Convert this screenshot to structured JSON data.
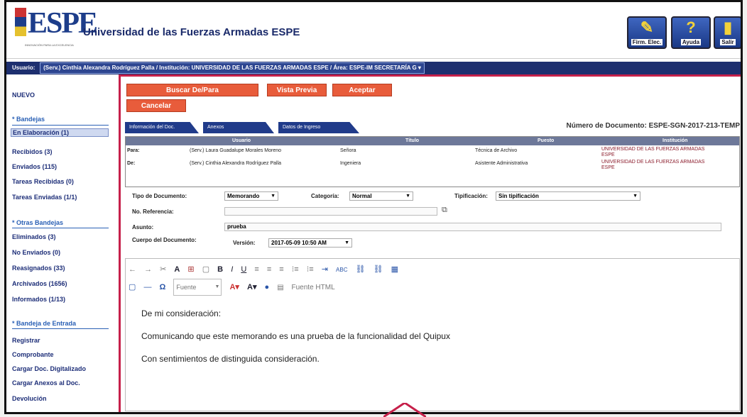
{
  "header": {
    "logo": "ESPE",
    "logo_sub": "INNOVACIÓN PARA LA EXCELENCIA",
    "university": "Universidad de las Fuerzas Armadas ESPE",
    "buttons": [
      {
        "label": "Firm. Elec.",
        "icon": "pen-icon"
      },
      {
        "label": "Ayuda",
        "icon": "help-icon"
      },
      {
        "label": "Salir",
        "icon": "exit-door-icon"
      }
    ]
  },
  "userbar": {
    "prefix": "Usuario:",
    "text": "(Serv.) Cinthia Alexandra Rodríguez Palla / Institución: UNIVERSIDAD DE LAS FUERZAS ARMADAS ESPE / Área: ESPE-IM SECRETARÍA G ▾"
  },
  "sidebar": {
    "nuevo": "NUEVO",
    "bandejas_title": "* Bandejas",
    "bandejas": [
      "En Elaboración (1)",
      "Recibidos (3)",
      "Enviados (115)",
      "Tareas Recibidas (0)",
      "Tareas Enviadas (1/1)"
    ],
    "otras_title": "* Otras Bandejas",
    "otras": [
      "Eliminados (3)",
      "No Enviados (0)",
      "Reasignados (33)",
      "Archivados (1656)",
      "Informados (1/13)"
    ],
    "entrada_title": "* Bandeja de Entrada",
    "entrada": [
      "Registrar",
      "Comprobante",
      "Cargar Doc. Digitalizado",
      "Cargar Anexos al Doc.",
      "Devolución"
    ]
  },
  "actions": {
    "buscar": "Buscar De/Para",
    "vista": "Vista Previa",
    "aceptar": "Aceptar",
    "cancelar": "Cancelar"
  },
  "tabs": [
    "Información del Doc.",
    "Anexos",
    "Datos de Ingreso"
  ],
  "doc_number": "Número de Documento: ESPE-SGN-2017-213-TEMP",
  "table": {
    "headers": [
      "Usuario",
      "Título",
      "Puesto",
      "Institución"
    ],
    "rows": [
      {
        "role": "Para:",
        "user": "(Serv.) Laura Guadalupe Morales Moreno",
        "title": "Señora",
        "puesto": "Técnica de Archivo",
        "inst": "UNIVERSIDAD DE LAS FUERZAS ARMADAS ESPE"
      },
      {
        "role": "De:",
        "user": "(Serv.) Cinthia Alexandra Rodríguez Palla",
        "title": "Ingeniera",
        "puesto": "Asistente Administrativa",
        "inst": "UNIVERSIDAD DE LAS FUERZAS ARMADAS ESPE"
      }
    ]
  },
  "form": {
    "tipo_label": "Tipo de Documento:",
    "tipo_value": "Memorando",
    "categoria_label": "Categoría:",
    "categoria_value": "Normal",
    "tipificacion_label": "Tipificación:",
    "tipificacion_value": "Sin tipificación",
    "referencia_label": "No. Referencia:",
    "asunto_label": "Asunto:",
    "asunto_value": "prueba",
    "cuerpo_label": "Cuerpo del Documento:",
    "version_label": "Versión:",
    "version_value": "2017-05-09 10:50 AM"
  },
  "editor": {
    "toolbar1": [
      "←",
      "→",
      "✂",
      "A",
      "⊞",
      "▢",
      "B",
      "I",
      "U",
      "≡",
      "≡",
      "≡",
      "⁝≡",
      "⁝≡",
      "⇥",
      "ABC",
      "⛓",
      "⛓",
      "▦"
    ],
    "font_placeholder": "Fuente",
    "source_label": "Fuente HTML",
    "paragraphs": [
      "De mi consideración:",
      "Comunicando que este memorando es una prueba de la funcionalidad del Quipux",
      "Con sentimientos de distinguida consideración."
    ]
  }
}
